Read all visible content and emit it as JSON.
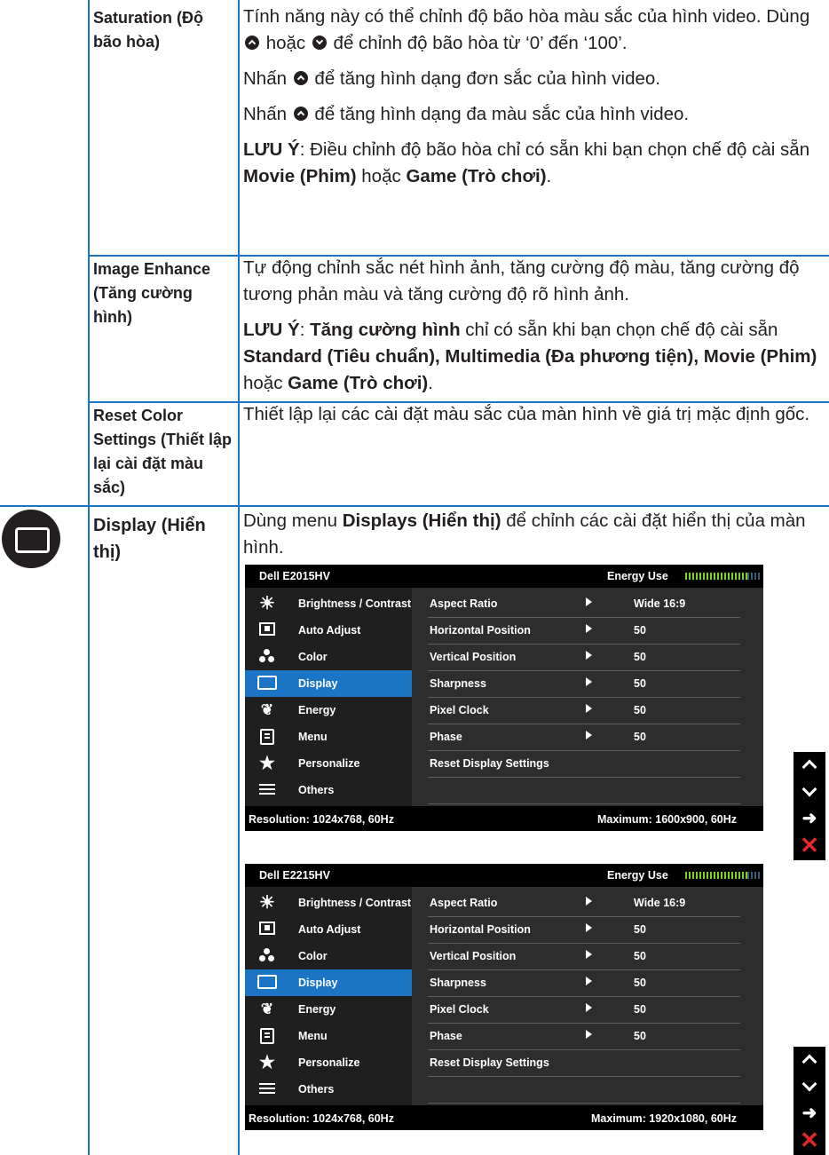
{
  "rows": {
    "saturation": {
      "label": "Saturation (Độ bão hòa)",
      "p1a": "Tính năng này có thể chỉnh độ bão hòa màu sắc của hình video. Dùng ",
      "p1b": " hoặc ",
      "p1c": " để chỉnh độ bão hòa từ ‘0’ đến ‘100’.",
      "p2a": "Nhấn ",
      "p2b": " để tăng hình dạng đơn sắc của hình video.",
      "p3a": "Nhấn ",
      "p3b": " để tăng hình dạng đa màu sắc của hình video.",
      "note_label": "LƯU Ý",
      "note_a": ": Điều chỉnh độ bão hòa chỉ có sẵn khi bạn chọn chế độ cài sẵn ",
      "note_movie": "Movie (Phim)",
      "note_or": " hoặc ",
      "note_game": "Game (Trò chơi)",
      "note_end": "."
    },
    "image_enhance": {
      "label": "Image Enhance (Tăng cường hình)",
      "p1": "Tự động chỉnh sắc nét hình ảnh, tăng cường độ màu, tăng cường độ tương phản màu và tăng cường độ rõ hình ảnh.",
      "note_label": "LƯU Ý",
      "note_colon": ": ",
      "note_feature": "Tăng cường hình",
      "note_a": " chỉ có sẵn khi bạn chọn chế độ cài sẵn ",
      "note_modes": "Standard (Tiêu chuẩn), Multimedia (Đa phương tiện), Movie (Phim)",
      "note_or": " hoặc ",
      "note_game": "Game (Trò chơi)",
      "note_end": "."
    },
    "reset_color": {
      "label": "Reset Color Settings (Thiết lập lại cài đặt màu sắc)",
      "p1": "Thiết lập lại các cài đặt màu sắc của màn hình về giá trị mặc định gốc."
    },
    "display": {
      "label": "Display (Hiển thị)",
      "p1a": "Dùng menu ",
      "p1b": "Displays (Hiển thị)",
      "p1c": " để chỉnh các cài đặt hiển thị của màn hình."
    }
  },
  "osd_menu": [
    "Brightness / Contrast",
    "Auto Adjust",
    "Color",
    "Display",
    "Energy",
    "Menu",
    "Personalize",
    "Others"
  ],
  "osd_settings": [
    {
      "name": "Aspect Ratio",
      "value": "Wide 16:9"
    },
    {
      "name": "Horizontal Position",
      "value": "50"
    },
    {
      "name": "Vertical Position",
      "value": "50"
    },
    {
      "name": "Sharpness",
      "value": "50"
    },
    {
      "name": "Pixel Clock",
      "value": "50"
    },
    {
      "name": "Phase",
      "value": "50"
    },
    {
      "name": "Reset Display Settings",
      "value": ""
    }
  ],
  "osd_energy_label": "Energy Use",
  "osd_resolution": "Resolution: 1024x768, 60Hz",
  "osd1": {
    "model": "Dell E2015HV",
    "maximum": "Maximum: 1600x900, 60Hz"
  },
  "osd2": {
    "model": "Dell E2215HV",
    "maximum": "Maximum: 1920x1080, 60Hz"
  },
  "colors": {
    "table_line": "#1b74c4",
    "selected": "#1b74c4",
    "exit": "#e8262a",
    "meter": "#7ed321"
  },
  "icons": [
    "up-button-icon",
    "down-button-icon",
    "display-icon",
    "sun-icon",
    "auto-adjust-icon",
    "color-dots-icon",
    "monitor-icon",
    "leaf-icon",
    "menu-icon",
    "star-icon",
    "sliders-icon",
    "chevron-up-icon",
    "chevron-down-icon",
    "arrow-right-icon",
    "close-icon"
  ]
}
